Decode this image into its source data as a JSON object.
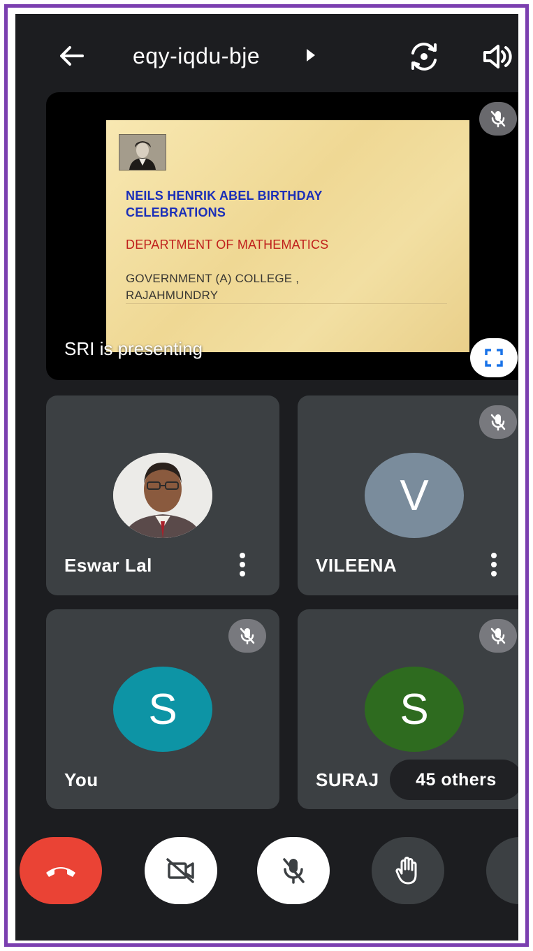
{
  "topbar": {
    "meeting_code": "eqy-iqdu-bje",
    "back_icon": "arrow-left-icon",
    "switch_camera_icon": "switch-camera-icon",
    "speaker_icon": "speaker-icon"
  },
  "presentation": {
    "presenting_label": "SRI is presenting",
    "slide": {
      "line1": "NEILS HENRIK ABEL BIRTHDAY",
      "line2": "CELEBRATIONS",
      "line3": "DEPARTMENT OF MATHEMATICS",
      "line4": "GOVERNMENT (A) COLLEGE ,",
      "line5": "RAJAHMUNDRY"
    },
    "muted": true
  },
  "participants": [
    {
      "name": "Eswar Lal",
      "avatar": "photo",
      "muted": false
    },
    {
      "name": "VILEENA",
      "avatar_letter": "V",
      "avatar_color": "#7a8c9c",
      "muted": true
    },
    {
      "name": "You",
      "avatar_letter": "S",
      "avatar_color": "#0d94a5",
      "muted": true
    },
    {
      "name": "SURAJ",
      "avatar_letter": "S",
      "avatar_color": "#2e6b1f",
      "muted": true
    }
  ],
  "others_label": "45 others",
  "controls": {
    "end_call_color": "#ea4335",
    "camera_state": "off",
    "mic_state": "off"
  },
  "colors": {
    "background": "#1c1d20",
    "tile": "#3c4043",
    "frame": "#7b3fb0",
    "accent_blue": "#1a73e8"
  }
}
